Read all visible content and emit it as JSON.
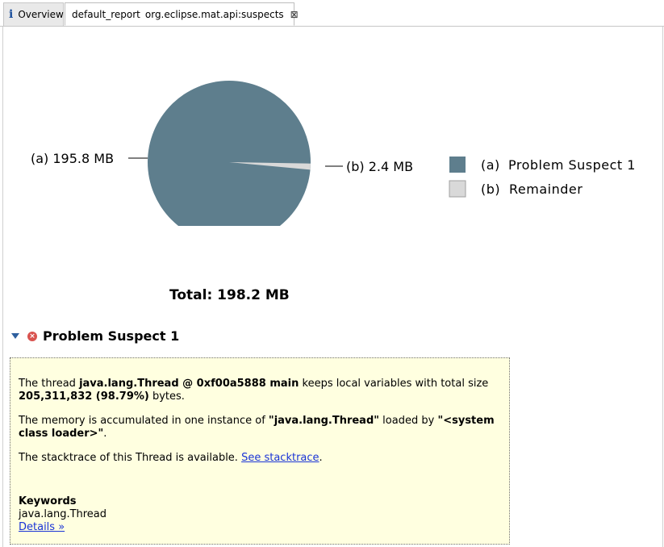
{
  "tabs": {
    "overview_label": "Overview",
    "report_name": "default_report",
    "report_id": "org.eclipse.mat.api:suspects",
    "close_glyph": "⊠"
  },
  "chart_data": {
    "type": "pie",
    "categories": [
      "Problem Suspect 1",
      "Remainder"
    ],
    "values": [
      195.8,
      2.4
    ],
    "unit": "MB",
    "slice_labels": [
      "(a)  195.8 MB",
      "(b)  2.4 MB"
    ],
    "legend": [
      {
        "key": "(a)",
        "label": "Problem Suspect 1",
        "color": "#5e7e8d"
      },
      {
        "key": "(b)",
        "label": "Remainder",
        "color": "#d9d9d9"
      }
    ],
    "legend_position": "right",
    "total_label": "Total:",
    "total_value": "198.2 MB"
  },
  "suspect": {
    "title": "Problem Suspect 1",
    "p1_pre": "The thread ",
    "p1_thread": "java.lang.Thread @ 0xf00a5888 main",
    "p1_mid": " keeps local variables with total size ",
    "p1_size": "205,311,832 (98.79%)",
    "p1_post": " bytes.",
    "p2_pre": "The memory is accumulated in one instance of ",
    "p2_class": "\"java.lang.Thread\"",
    "p2_mid": " loaded by ",
    "p2_loader": "\"<system class loader>\"",
    "p2_post": ".",
    "p3_pre": "The stacktrace of this Thread is available. ",
    "p3_link": "See stacktrace",
    "p3_post": ".",
    "keywords_title": "Keywords",
    "keyword": "java.lang.Thread",
    "details_link": "Details »"
  },
  "colors": {
    "accent_link": "#1a34d6",
    "panel_bg": "#ffffe0",
    "slice_a": "#5e7e8d",
    "slice_b": "#d9d9d9"
  }
}
